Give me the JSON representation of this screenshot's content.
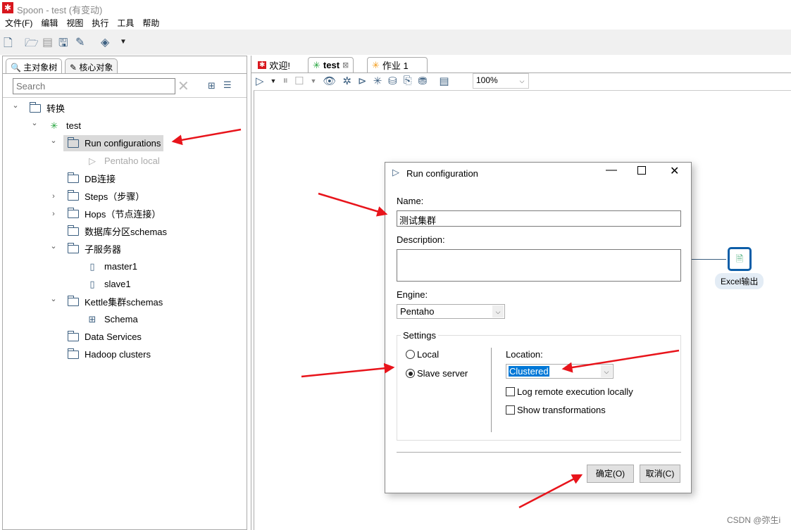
{
  "window": {
    "title": "Spoon - test (有变动)"
  },
  "menu": [
    "文件(F)",
    "编辑",
    "视图",
    "执行",
    "工具",
    "帮助"
  ],
  "left_panel": {
    "tabs": [
      "主对象树",
      "核心对象"
    ],
    "search_placeholder": "Search",
    "tree": [
      {
        "label": "转换",
        "level": 0,
        "expanded": true,
        "icon": "folder-icon"
      },
      {
        "label": "test",
        "level": 1,
        "expanded": true,
        "icon": "transformation-icon"
      },
      {
        "label": "Run configurations",
        "level": 2,
        "expanded": true,
        "icon": "folder-icon",
        "selected": true
      },
      {
        "label": "Pentaho local",
        "level": 3,
        "icon": "run-icon",
        "disabled": true
      },
      {
        "label": "DB连接",
        "level": 2,
        "icon": "folder-icon"
      },
      {
        "label": "Steps（步骤）",
        "level": 2,
        "expanded": false,
        "icon": "folder-icon"
      },
      {
        "label": "Hops（节点连接）",
        "level": 2,
        "expanded": false,
        "icon": "folder-icon"
      },
      {
        "label": "数据库分区schemas",
        "level": 2,
        "icon": "folder-icon"
      },
      {
        "label": "子服务器",
        "level": 2,
        "expanded": true,
        "icon": "folder-icon"
      },
      {
        "label": "master1",
        "level": 3,
        "icon": "server-icon"
      },
      {
        "label": "slave1",
        "level": 3,
        "icon": "server-icon"
      },
      {
        "label": "Kettle集群schemas",
        "level": 2,
        "expanded": true,
        "icon": "folder-icon"
      },
      {
        "label": "Schema",
        "level": 3,
        "icon": "cluster-schema-icon"
      },
      {
        "label": "Data Services",
        "level": 2,
        "icon": "folder-icon"
      },
      {
        "label": "Hadoop clusters",
        "level": 2,
        "icon": "folder-icon"
      }
    ]
  },
  "editor": {
    "tabs": [
      {
        "label": "欢迎!"
      },
      {
        "label": "test",
        "active": true
      },
      {
        "label": "作业 1"
      }
    ],
    "zoom": "100%",
    "step": {
      "label": "Excel输出"
    }
  },
  "dialog": {
    "title": "Run configuration",
    "name_label": "Name:",
    "name_value": "测试集群",
    "description_label": "Description:",
    "description_value": "",
    "engine_label": "Engine:",
    "engine_value": "Pentaho",
    "settings_label": "Settings",
    "radio_local": "Local",
    "radio_slave": "Slave server",
    "selected": "Slave server",
    "location_label": "Location:",
    "location_value": "Clustered",
    "log_remote": "Log remote execution locally",
    "log_remote_checked": false,
    "show_trans": "Show transformations",
    "show_trans_checked": false,
    "ok": "确定(O)",
    "cancel": "取消(C)"
  },
  "watermark": "CSDN @弥生i",
  "colors": {
    "accent": "#3c5f80",
    "annotation": "#e8141b",
    "selection": "#0078d7"
  }
}
